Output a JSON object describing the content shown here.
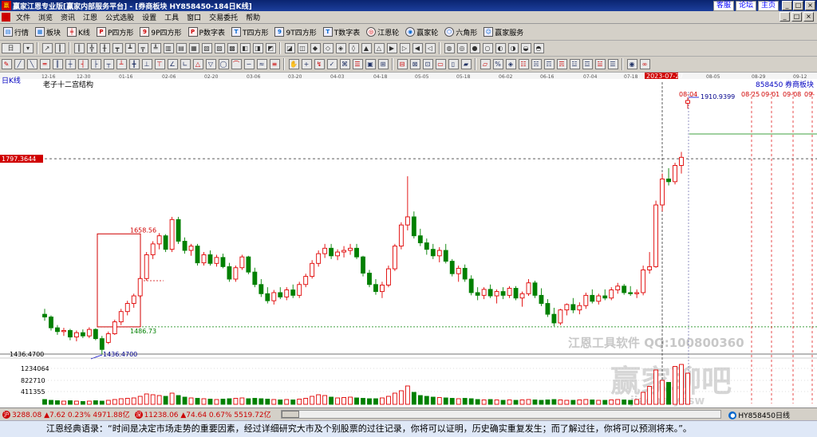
{
  "window": {
    "title": "赢家江恩专业版[赢家内部服务平台] - [券商板块  HY858450-184日K线]",
    "links": [
      "客服",
      "论坛",
      "主页"
    ],
    "controls": [
      "_",
      "□",
      "×"
    ]
  },
  "menu": {
    "items": [
      "文件",
      "浏览",
      "资讯",
      "江恩",
      "公式选股",
      "设置",
      "工具",
      "窗口",
      "交易委托",
      "帮助"
    ],
    "controls": [
      "_",
      "□",
      "×"
    ]
  },
  "toolbar": {
    "items": [
      {
        "label": "行情",
        "icon": "quote-icon"
      },
      {
        "label": "板块",
        "icon": "sector-icon"
      },
      {
        "label": "K线",
        "icon": "kline-icon"
      },
      {
        "label": "P四方形",
        "icon": "p-square-icon"
      },
      {
        "label": "9P四方形",
        "icon": "9p-square-icon"
      },
      {
        "label": "P数字表",
        "icon": "p-number-icon"
      },
      {
        "label": "T四方形",
        "icon": "t-square-icon"
      },
      {
        "label": "9T四方形",
        "icon": "9t-square-icon"
      },
      {
        "label": "T数字表",
        "icon": "t-number-icon"
      },
      {
        "label": "江恩轮",
        "icon": "gann-wheel-icon"
      },
      {
        "label": "赢家轮",
        "icon": "winner-wheel-icon"
      },
      {
        "label": "六角形",
        "icon": "hexagon-icon"
      },
      {
        "label": "赢家服务",
        "icon": "service-icon"
      }
    ],
    "period_selector": "日"
  },
  "chart": {
    "period_label": "日K线",
    "study_label": "老子十二宫结构",
    "code": "858450",
    "name": "券商板块",
    "left_price_tag": "1797.3644",
    "bottom_price_tag": "1436.4700",
    "high_label": "1910.9399",
    "box_top_label": "1658.56",
    "box_bottom_label": "1486.73",
    "low_label": "1436.4700",
    "cursor_date": "2023-07-27",
    "high_date": "08-04",
    "future_dates": [
      "08-25",
      "09-01",
      "09-08",
      "09-"
    ],
    "dates": [
      "12-16",
      "12-30",
      "01-16",
      "02-06",
      "02-20",
      "03-06",
      "03-20",
      "04-03",
      "04-18",
      "05-05",
      "05-18",
      "06-02",
      "06-16",
      "07-04",
      "07-18",
      "08-05",
      "08-29",
      "09-12"
    ],
    "vol_ticks": [
      "1234064",
      "822710",
      "411355"
    ],
    "watermark1": "江恩工具软件  QQ:100800360",
    "watermark2": "赢家聊吧",
    "watermark3": "jiaoba.yesw",
    "colors": {
      "up": "#e00000",
      "down": "#008000",
      "box": "#d00000"
    }
  },
  "chart_data": {
    "type": "candlestick",
    "ylim": [
      1400,
      1950
    ],
    "ohlc": [
      [
        1510,
        1520,
        1498,
        1505
      ],
      [
        1505,
        1508,
        1480,
        1485
      ],
      [
        1485,
        1490,
        1472,
        1478
      ],
      [
        1478,
        1485,
        1470,
        1480
      ],
      [
        1480,
        1483,
        1462,
        1468
      ],
      [
        1468,
        1480,
        1460,
        1476
      ],
      [
        1476,
        1482,
        1466,
        1470
      ],
      [
        1470,
        1486,
        1466,
        1482
      ],
      [
        1482,
        1484,
        1462,
        1465
      ],
      [
        1465,
        1470,
        1436,
        1445
      ],
      [
        1458,
        1478,
        1455,
        1474
      ],
      [
        1474,
        1500,
        1472,
        1496
      ],
      [
        1496,
        1520,
        1490,
        1515
      ],
      [
        1515,
        1535,
        1508,
        1530
      ],
      [
        1530,
        1548,
        1522,
        1544
      ],
      [
        1544,
        1580,
        1540,
        1576
      ],
      [
        1576,
        1625,
        1572,
        1620
      ],
      [
        1620,
        1645,
        1612,
        1640
      ],
      [
        1640,
        1660,
        1630,
        1655
      ],
      [
        1655,
        1658,
        1625,
        1630
      ],
      [
        1630,
        1690,
        1625,
        1685
      ],
      [
        1685,
        1690,
        1640,
        1645
      ],
      [
        1645,
        1652,
        1622,
        1628
      ],
      [
        1628,
        1640,
        1618,
        1636
      ],
      [
        1636,
        1640,
        1600,
        1605
      ],
      [
        1605,
        1625,
        1600,
        1620
      ],
      [
        1620,
        1628,
        1600,
        1604
      ],
      [
        1604,
        1620,
        1598,
        1615
      ],
      [
        1615,
        1622,
        1595,
        1598
      ],
      [
        1598,
        1605,
        1570,
        1575
      ],
      [
        1575,
        1600,
        1570,
        1596
      ],
      [
        1596,
        1620,
        1592,
        1616
      ],
      [
        1616,
        1618,
        1584,
        1588
      ],
      [
        1588,
        1596,
        1560,
        1565
      ],
      [
        1565,
        1575,
        1542,
        1548
      ],
      [
        1548,
        1560,
        1530,
        1535
      ],
      [
        1535,
        1555,
        1528,
        1550
      ],
      [
        1550,
        1560,
        1538,
        1542
      ],
      [
        1542,
        1560,
        1536,
        1555
      ],
      [
        1555,
        1565,
        1540,
        1545
      ],
      [
        1545,
        1570,
        1540,
        1565
      ],
      [
        1565,
        1585,
        1560,
        1580
      ],
      [
        1580,
        1610,
        1576,
        1604
      ],
      [
        1604,
        1628,
        1598,
        1622
      ],
      [
        1622,
        1640,
        1614,
        1632
      ],
      [
        1632,
        1640,
        1612,
        1618
      ],
      [
        1618,
        1630,
        1610,
        1625
      ],
      [
        1625,
        1636,
        1615,
        1628
      ],
      [
        1628,
        1640,
        1620,
        1632
      ],
      [
        1632,
        1640,
        1612,
        1616
      ],
      [
        1616,
        1618,
        1580,
        1586
      ],
      [
        1586,
        1592,
        1560,
        1565
      ],
      [
        1565,
        1575,
        1546,
        1552
      ],
      [
        1552,
        1570,
        1540,
        1564
      ],
      [
        1564,
        1600,
        1560,
        1594
      ],
      [
        1594,
        1640,
        1590,
        1636
      ],
      [
        1636,
        1680,
        1630,
        1675
      ],
      [
        1675,
        1765,
        1665,
        1690
      ],
      [
        1690,
        1700,
        1650,
        1655
      ],
      [
        1655,
        1668,
        1636,
        1642
      ],
      [
        1642,
        1650,
        1620,
        1630
      ],
      [
        1630,
        1640,
        1612,
        1618
      ],
      [
        1618,
        1634,
        1606,
        1628
      ],
      [
        1628,
        1640,
        1604,
        1608
      ],
      [
        1608,
        1612,
        1580,
        1585
      ],
      [
        1585,
        1600,
        1570,
        1595
      ],
      [
        1595,
        1602,
        1570,
        1575
      ],
      [
        1575,
        1582,
        1545,
        1550
      ],
      [
        1550,
        1560,
        1536,
        1545
      ],
      [
        1545,
        1560,
        1538,
        1556
      ],
      [
        1556,
        1565,
        1540,
        1544
      ],
      [
        1544,
        1556,
        1530,
        1552
      ],
      [
        1552,
        1560,
        1538,
        1545
      ],
      [
        1545,
        1562,
        1540,
        1558
      ],
      [
        1558,
        1562,
        1536,
        1540
      ],
      [
        1540,
        1552,
        1524,
        1548
      ],
      [
        1548,
        1575,
        1544,
        1568
      ],
      [
        1568,
        1572,
        1540,
        1545
      ],
      [
        1545,
        1558,
        1525,
        1530
      ],
      [
        1530,
        1538,
        1505,
        1510
      ],
      [
        1510,
        1522,
        1488,
        1494
      ],
      [
        1494,
        1520,
        1490,
        1518
      ],
      [
        1518,
        1530,
        1508,
        1528
      ],
      [
        1528,
        1540,
        1512,
        1518
      ],
      [
        1518,
        1532,
        1510,
        1526
      ],
      [
        1526,
        1550,
        1520,
        1545
      ],
      [
        1545,
        1556,
        1530,
        1534
      ],
      [
        1534,
        1548,
        1528,
        1544
      ],
      [
        1544,
        1556,
        1536,
        1540
      ],
      [
        1540,
        1560,
        1536,
        1555
      ],
      [
        1555,
        1568,
        1548,
        1562
      ],
      [
        1562,
        1566,
        1546,
        1550
      ],
      [
        1550,
        1562,
        1544,
        1548
      ],
      [
        1548,
        1556,
        1540,
        1550
      ],
      [
        1550,
        1600,
        1545,
        1592
      ],
      [
        1592,
        1625,
        1585,
        1598
      ],
      [
        1598,
        1720,
        1596,
        1712
      ],
      [
        1712,
        1770,
        1700,
        1760
      ],
      [
        1760,
        1780,
        1748,
        1755
      ],
      [
        1755,
        1790,
        1750,
        1785
      ],
      [
        1785,
        1810,
        1770,
        1800
      ],
      [
        1900,
        1911,
        1890,
        1905
      ]
    ],
    "volume": [
      0.12,
      0.1,
      0.09,
      0.08,
      0.09,
      0.08,
      0.07,
      0.08,
      0.09,
      0.08,
      0.1,
      0.12,
      0.14,
      0.15,
      0.16,
      0.2,
      0.26,
      0.24,
      0.22,
      0.2,
      0.28,
      0.22,
      0.18,
      0.16,
      0.15,
      0.14,
      0.13,
      0.12,
      0.13,
      0.14,
      0.15,
      0.16,
      0.14,
      0.15,
      0.14,
      0.13,
      0.12,
      0.11,
      0.12,
      0.11,
      0.13,
      0.15,
      0.2,
      0.24,
      0.22,
      0.18,
      0.16,
      0.17,
      0.18,
      0.16,
      0.15,
      0.14,
      0.14,
      0.16,
      0.2,
      0.28,
      0.34,
      0.46,
      0.3,
      0.22,
      0.2,
      0.18,
      0.17,
      0.16,
      0.15,
      0.14,
      0.15,
      0.14,
      0.12,
      0.11,
      0.12,
      0.11,
      0.1,
      0.11,
      0.1,
      0.11,
      0.12,
      0.11,
      0.1,
      0.11,
      0.12,
      0.11,
      0.1,
      0.1,
      0.11,
      0.12,
      0.11,
      0.1,
      0.1,
      0.11,
      0.12,
      0.11,
      0.1,
      0.12,
      0.3,
      0.45,
      0.86,
      0.6,
      0.55,
      0.95,
      1.0,
      0.78
    ]
  }
}
